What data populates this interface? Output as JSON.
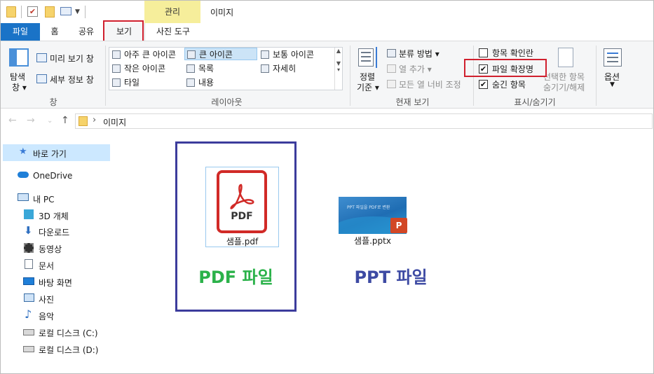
{
  "title_bar": {
    "context_tab": "관리",
    "window_title": "이미지"
  },
  "ribbon_tabs": {
    "file": "파일",
    "home": "홈",
    "share": "공유",
    "view": "보기",
    "picture_tools": "사진 도구"
  },
  "ribbon": {
    "pane_group": {
      "nav_pane_line1": "탐색",
      "nav_pane_line2": "창",
      "preview_pane": "미리 보기 창",
      "details_pane": "세부 정보 창",
      "label": "창"
    },
    "layout_group": {
      "items": [
        "아주 큰 아이콘",
        "큰 아이콘",
        "보통 아이콘",
        "작은 아이콘",
        "목록",
        "자세히",
        "타일",
        "내용"
      ],
      "selected": "큰 아이콘",
      "label": "레이아웃"
    },
    "current_view_group": {
      "sort_line1": "정렬",
      "sort_line2": "기준",
      "group_by": "분류 방법",
      "add_columns": "열 추가",
      "size_columns": "모든 열 너비 조정",
      "label": "현재 보기"
    },
    "show_hide_group": {
      "item_checkboxes": "항목 확인란",
      "item_checkboxes_checked": false,
      "file_extensions": "파일 확장명",
      "file_extensions_checked": true,
      "hidden_items": "숨긴 항목",
      "hidden_items_checked": true,
      "hide_selected_line1": "선택한 항목",
      "hide_selected_line2": "숨기기/해제",
      "label": "표시/숨기기"
    },
    "options_group": {
      "options": "옵션"
    }
  },
  "address_bar": {
    "separator": "›",
    "path": "이미지"
  },
  "sidebar": {
    "quick_access": "바로 가기",
    "onedrive": "OneDrive",
    "this_pc": "내 PC",
    "items": [
      "3D 개체",
      "다운로드",
      "동영상",
      "문서",
      "바탕 화면",
      "사진",
      "음악",
      "로컬 디스크 (C:)",
      "로컬 디스크 (D:)"
    ]
  },
  "files": [
    {
      "name": "샘플.pdf",
      "icon_label": "PDF"
    },
    {
      "name": "샘플.pptx",
      "thumb_text": "PPT 파일을 PDF로 변환"
    }
  ],
  "captions": {
    "pdf": "PDF 파일",
    "ppt": "PPT 파일"
  },
  "colors": {
    "file_tab": "#1a73c7",
    "highlight_red": "#d0202e",
    "blue_box": "#3c3c9c",
    "pdf_caption": "#2bb24a",
    "ppt_caption": "#3d4aa3",
    "pdf_icon": "#d12a27",
    "selection": "#cce8ff"
  }
}
